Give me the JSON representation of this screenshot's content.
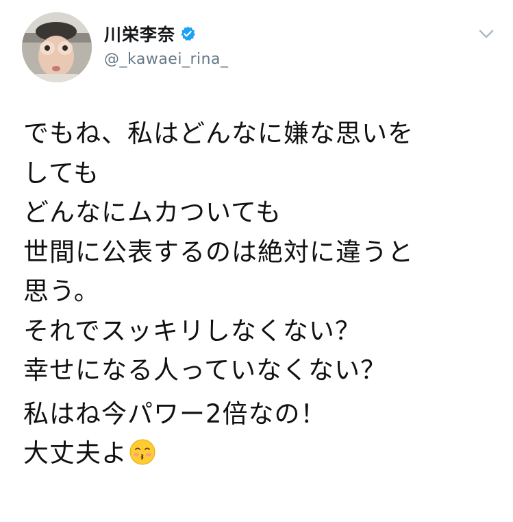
{
  "user": {
    "display_name": "川栄李奈",
    "handle": "@_kawaei_rina_",
    "verified_icon": "verified-badge-icon",
    "avatar_icon": "profile-photo"
  },
  "menu_icon": "chevron-down-icon",
  "tweet": {
    "lines": [
      "でもね、私はどんなに嫌な思いを",
      "しても",
      "どんなにムカついても",
      "世間に公表するのは絶対に違うと",
      "思う。",
      "それでスッキリしなくない？",
      "幸せになる人っていなくない？",
      "私はね今パワー2倍なの！",
      "大丈夫よ"
    ],
    "emoji": "kissing-face-with-closed-eyes-emoji"
  },
  "colors": {
    "verified": "#1da1f2",
    "handle": "#657786",
    "text": "#111111",
    "caret": "#aab8c2"
  }
}
